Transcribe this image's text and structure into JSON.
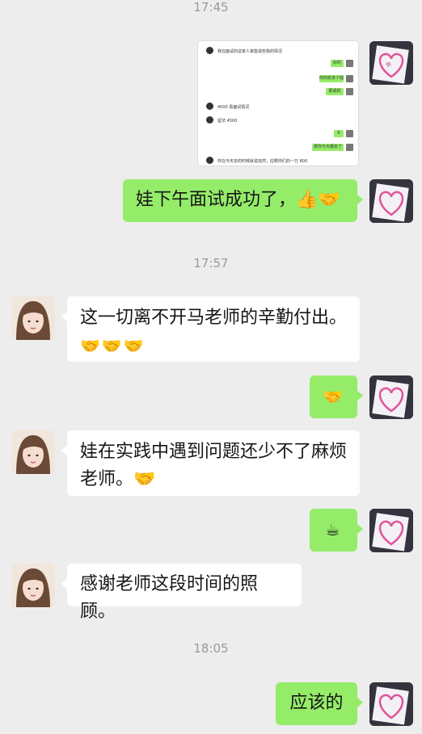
{
  "chat": {
    "time_1": "17:45",
    "time_2": "17:57",
    "time_3": "18:05",
    "msg_interview": "娃下午面试成功了，👍🤝",
    "msg_thanks_effort": "这一切离不开马老师的辛勤付出。",
    "msg_thanks_effort_emoji": "🤝🤝🤝",
    "msg_handshake": "🤝",
    "msg_trouble_line1": "娃在实践中遇到问题还少不了麻烦",
    "msg_trouble_line2": "老师。🤝",
    "msg_coffee": "☕",
    "msg_care": "感谢老师这段时间的照顾。",
    "msg_reply": "应该的"
  },
  "screenshot_snippet": {
    "line1": "我在面试的这家人家能说些我的情况",
    "btn1": "好的",
    "btn2": "你的收多少钱",
    "btn3": "那成的",
    "line2": "4000 看面试情况",
    "line3": "留法 4500",
    "btn4": "6",
    "btn5": "那你今天都去了",
    "line4": "你在今天去的时候就说完然，应聘你们的一万 800"
  },
  "colors": {
    "background": "#ededed",
    "outgoing_bubble": "#95ec69",
    "incoming_bubble": "#ffffff",
    "timestamp": "#9a9a9a"
  }
}
